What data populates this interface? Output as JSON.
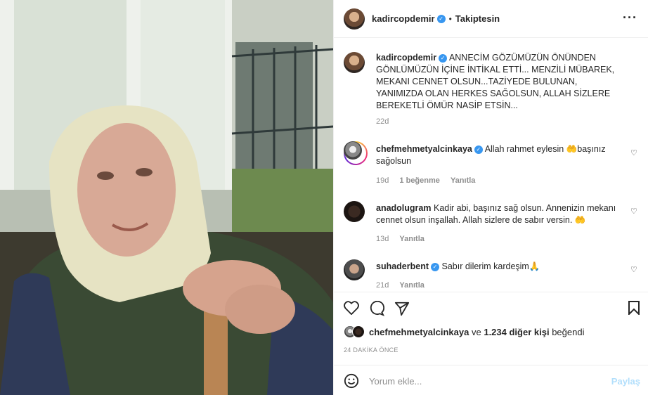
{
  "post": {
    "username": "kadircopdemir",
    "separator": "•",
    "follow_status": "Takiptesin",
    "more_icon": "more-options-icon",
    "caption": "ANNECİM GÖZÜMÜZÜN ÖNÜNDEN GÖNLÜMÜZÜN İÇİNE İNTİKAL ETTİ... MENZİLİ MÜBAREK, MEKANI CENNET OLSUN...TAZİYEDE BULUNAN, YANIMIZDA OLAN HERKES SAĞOLSUN, ALLAH SİZLERE BEREKETLİ ÖMÜR NASİP ETSİN...",
    "caption_time": "22d"
  },
  "comments": [
    {
      "username": "chefmehmetyalcinkaya",
      "text": "Allah rahmet eylesin 🤲başınız sağolsun",
      "time": "19d",
      "likes": "1 beğenme",
      "reply": "Yanıtla"
    },
    {
      "username": "anadolugram",
      "text": "Kadir abi, başınız sağ olsun. Annenizin mekanı cennet olsun inşallah. Allah sizlere de sabır versin. 🤲",
      "time": "13d",
      "reply": "Yanıtla"
    },
    {
      "username": "suhaderbent",
      "text": "Sabır dilerim kardeşim🙏",
      "time": "21d",
      "reply": "Yanıtla"
    }
  ],
  "likes_line": {
    "user": "chefmehmetyalcinkaya",
    "connector": "ve",
    "others": "1.234 diğer kişi",
    "suffix": "beğendi"
  },
  "posted_ago": "24 DAKİKA ÖNCE",
  "compose": {
    "placeholder": "Yorum ekle...",
    "share_label": "Paylaş"
  },
  "colors": {
    "verified": "#3897f0",
    "share_disabled": "#b2dffc",
    "muted": "#8e8e8e"
  }
}
